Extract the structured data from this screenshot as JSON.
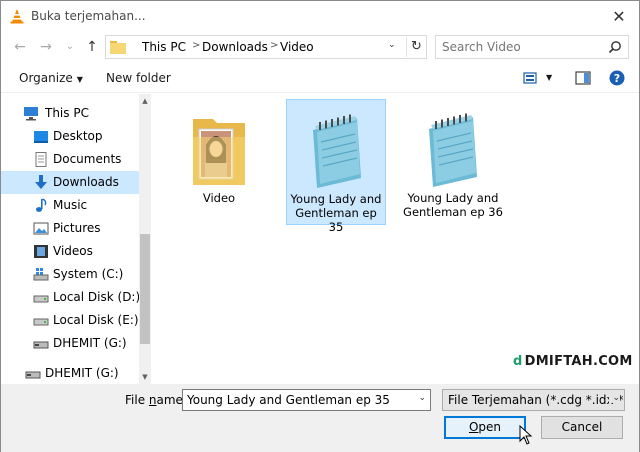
{
  "window": {
    "title": "Buka terjemahan...",
    "close_glyph": "✕"
  },
  "nav": {
    "back_glyph": "←",
    "forward_glyph": "→",
    "recent_glyph": "⌄",
    "up_glyph": "↑",
    "breadcrumb": [
      "This PC",
      "Downloads",
      "Video"
    ],
    "refresh_glyph": "↻",
    "search_placeholder": "Search Video"
  },
  "toolbar": {
    "organize_label": "Organize",
    "new_folder_label": "New folder",
    "help_glyph": "?"
  },
  "sidebar": {
    "items": [
      {
        "label": "This PC",
        "icon": "pc-icon"
      },
      {
        "label": "Desktop",
        "icon": "desktop-icon"
      },
      {
        "label": "Documents",
        "icon": "documents-icon"
      },
      {
        "label": "Downloads",
        "icon": "downloads-icon",
        "selected": true
      },
      {
        "label": "Music",
        "icon": "music-icon"
      },
      {
        "label": "Pictures",
        "icon": "pictures-icon"
      },
      {
        "label": "Videos",
        "icon": "videos-icon"
      },
      {
        "label": "System (C:)",
        "icon": "drive-windows-icon"
      },
      {
        "label": "Local Disk (D:)",
        "icon": "drive-icon"
      },
      {
        "label": "Local Disk (E:)",
        "icon": "drive-icon"
      },
      {
        "label": "DHEMIT (G:)",
        "icon": "usb-drive-icon"
      },
      {
        "label": "DHEMIT (G:)",
        "icon": "usb-drive-icon"
      }
    ]
  },
  "files": [
    {
      "name": "Video",
      "type": "folder-icon"
    },
    {
      "name": "Young Lady and Gentleman ep 35",
      "type": "notepad-file-icon",
      "selected": true
    },
    {
      "name": "Young Lady and Gentleman ep 36",
      "type": "notepad-file-icon"
    }
  ],
  "watermark": {
    "text": "DMIFTAH.COM",
    "logo_glyph": "d"
  },
  "bottom": {
    "file_name_label_pre": "File ",
    "file_name_label_u": "n",
    "file_name_label_post": "ame:",
    "file_name_value": "Young Lady and Gentleman ep 35",
    "filter_value": "File Terjemahan (*.cdg *.idx *.s",
    "open_label_u": "O",
    "open_label_rest": "pen",
    "cancel_label": "Cancel",
    "dropdown_glyph": "⌄"
  },
  "colors": {
    "selection": "#cce8ff",
    "accent": "#0078d7",
    "footer": "#f0f0f0"
  }
}
